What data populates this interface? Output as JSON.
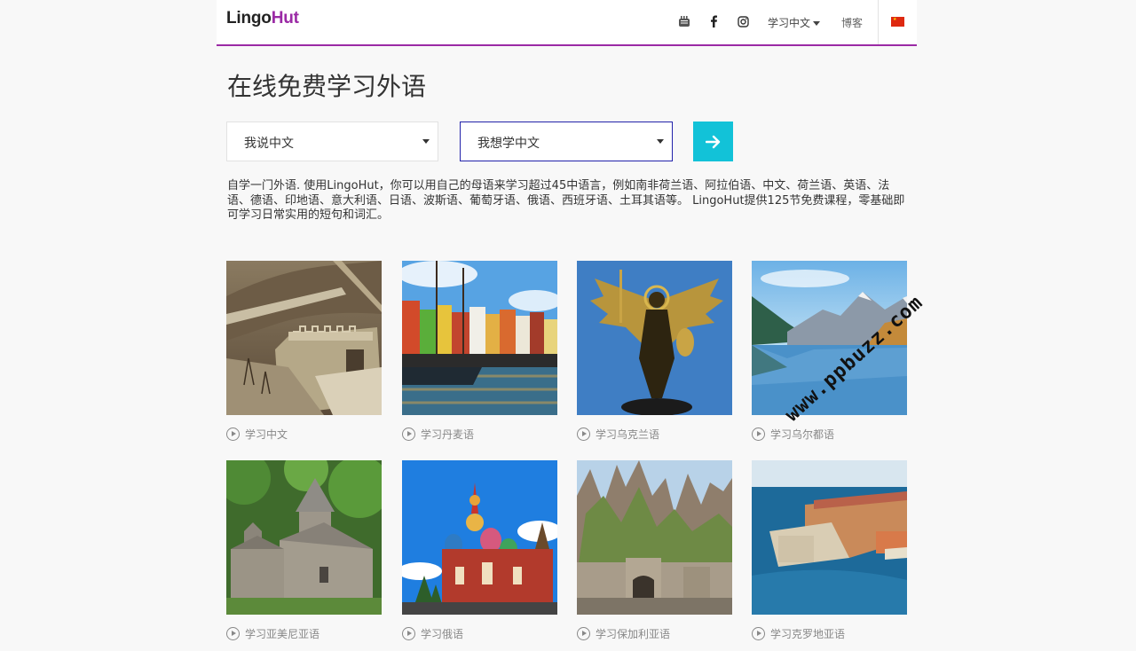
{
  "header": {
    "logo_part1": "Lingo",
    "logo_part2": "Hut",
    "nav": {
      "youtube_icon": "youtube-icon",
      "facebook_icon": "facebook-icon",
      "instagram_icon": "instagram-icon",
      "language_menu": "学习中文",
      "blog": "博客",
      "flag": "china-flag-icon"
    }
  },
  "main": {
    "title": "在线免费学习外语",
    "speak_select": "我说中文",
    "learn_select": "我想学中文",
    "description": "自学一门外语. 使用LingoHut，你可以用自己的母语来学习超过45中语言，例如南非荷兰语、阿拉伯语、中文、荷兰语、英语、法语、德语、印地语、意大利语、日语、波斯语、葡萄牙语、俄语、西班牙语、土耳其语等。 LingoHut提供125节免费课程，零基础即可学习日常实用的短句和词汇。"
  },
  "courses": [
    {
      "label": "学习中文"
    },
    {
      "label": "学习丹麦语"
    },
    {
      "label": "学习乌克兰语"
    },
    {
      "label": "学习乌尔都语"
    },
    {
      "label": "学习亚美尼亚语"
    },
    {
      "label": "学习俄语"
    },
    {
      "label": "学习保加利亚语"
    },
    {
      "label": "学习克罗地亚语"
    }
  ],
  "watermark": "www.ppbuzz.com",
  "colors": {
    "brand_purple": "#9b2aa5",
    "go_button": "#12c2d8",
    "learn_select_border": "#2222aa",
    "page_background": "#f8f8f8"
  }
}
